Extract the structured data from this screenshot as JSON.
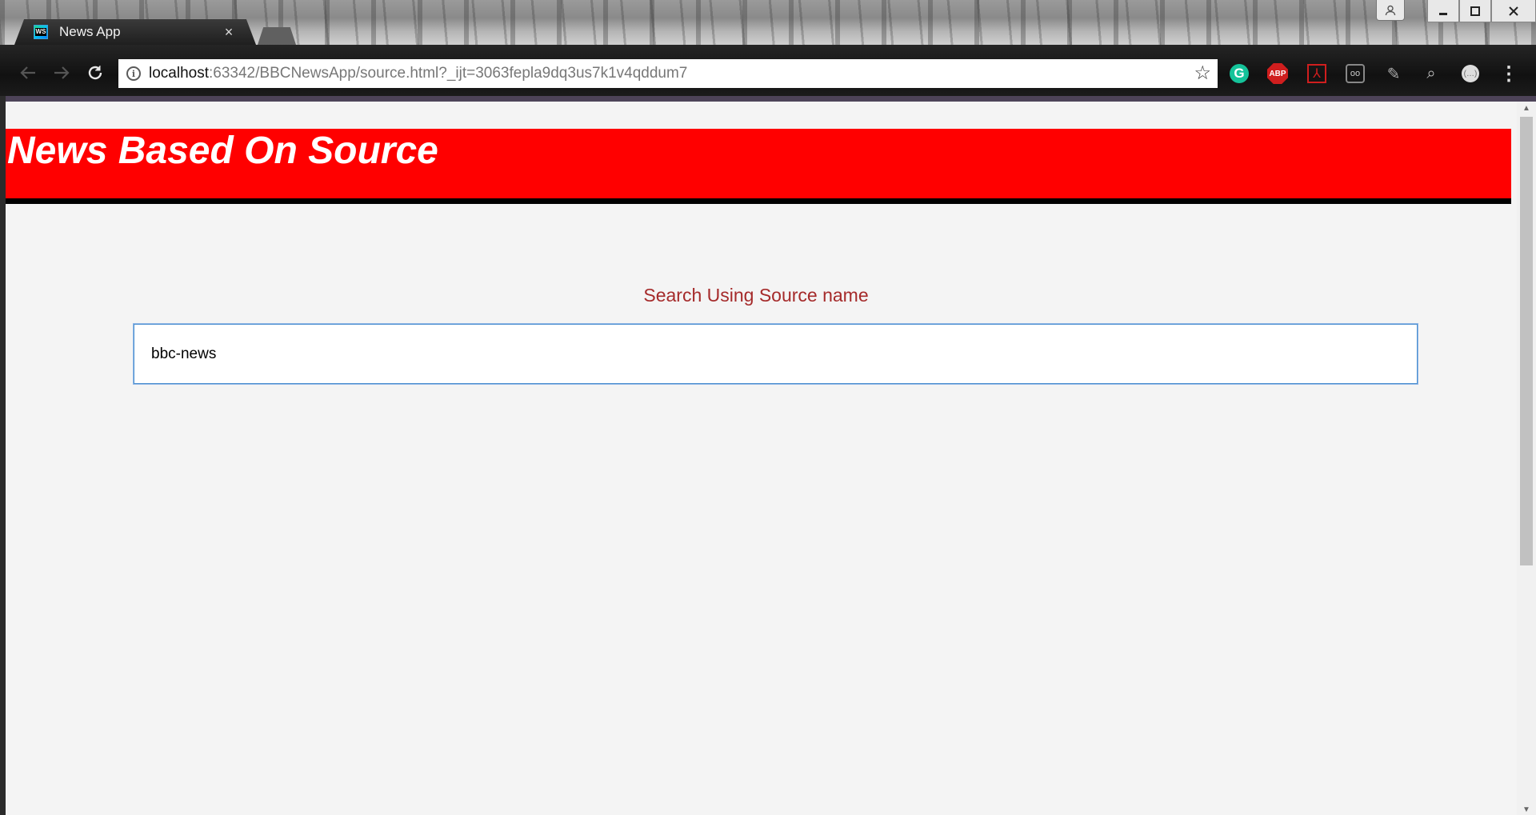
{
  "browser": {
    "tab_title": "News App",
    "tab_favicon_text": "WS",
    "tab_close": "×",
    "url_host": "localhost",
    "url_rest": ":63342/BBCNewsApp/source.html?_ijt=3063fepla9dq3us7k1v4qddum7",
    "extensions": [
      {
        "name": "grammarly-icon",
        "glyph": "G"
      },
      {
        "name": "adblock-icon",
        "glyph": "ABP"
      },
      {
        "name": "acrobat-pdf-icon",
        "glyph": "⅄"
      },
      {
        "name": "glasses-extension-icon",
        "glyph": "oo"
      },
      {
        "name": "wand-extension-icon",
        "glyph": "✎"
      },
      {
        "name": "search-extension-icon",
        "glyph": "⌕"
      },
      {
        "name": "circle-extension-icon",
        "glyph": "(…)"
      }
    ]
  },
  "page": {
    "banner_title": "News Based On Source",
    "search_label": "Search Using Source name",
    "search_value": "bbc-news"
  },
  "colors": {
    "banner_bg": "#ff0000",
    "label_color": "#a52a2a",
    "page_bg": "#f4f4f4"
  }
}
